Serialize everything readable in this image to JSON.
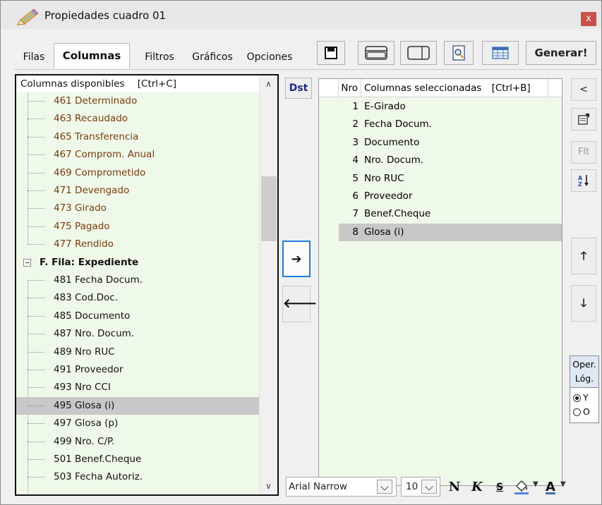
{
  "window": {
    "title": "Propiedades cuadro 01",
    "close_label": "x"
  },
  "tabs": [
    {
      "label": "Filas",
      "active": false
    },
    {
      "label": "Columnas",
      "active": true
    },
    {
      "label": "Filtros",
      "active": false
    },
    {
      "label": "Gráficos",
      "active": false
    },
    {
      "label": "Opciones",
      "active": false
    }
  ],
  "toolbar": {
    "buttons": [
      "save-icon",
      "layout-top-icon",
      "layout-split-icon",
      "preview-icon",
      "grid-icon"
    ],
    "generate_label": "Generar!"
  },
  "available_columns": {
    "header": "Columnas disponibles",
    "shortcut": "[Ctrl+C]",
    "rows": [
      {
        "label": "461 Determinado",
        "kind": "item",
        "color": "brown"
      },
      {
        "label": "463 Recaudado",
        "kind": "item",
        "color": "brown"
      },
      {
        "label": "465 Transferencia",
        "kind": "item",
        "color": "brown"
      },
      {
        "label": "467 Comprom. Anual",
        "kind": "item",
        "color": "brown"
      },
      {
        "label": "469 Comprometido",
        "kind": "item",
        "color": "brown"
      },
      {
        "label": "471 Devengado",
        "kind": "item",
        "color": "brown"
      },
      {
        "label": "473 Girado",
        "kind": "item",
        "color": "brown"
      },
      {
        "label": "475 Pagado",
        "kind": "item",
        "color": "brown"
      },
      {
        "label": "477 Rendido",
        "kind": "item",
        "color": "brown"
      },
      {
        "label": "F. Fila: Expediente",
        "kind": "group",
        "color": "black"
      },
      {
        "label": "481 Fecha Docum.",
        "kind": "item",
        "color": "black"
      },
      {
        "label": "483 Cod.Doc.",
        "kind": "item",
        "color": "black"
      },
      {
        "label": "485 Documento",
        "kind": "item",
        "color": "black"
      },
      {
        "label": "487 Nro. Docum.",
        "kind": "item",
        "color": "black"
      },
      {
        "label": "489 Nro RUC",
        "kind": "item",
        "color": "black"
      },
      {
        "label": "491 Proveedor",
        "kind": "item",
        "color": "black"
      },
      {
        "label": "493 Nro CCI",
        "kind": "item",
        "color": "black"
      },
      {
        "label": "495 Glosa (i)",
        "kind": "item",
        "color": "black",
        "selected": true
      },
      {
        "label": "497 Glosa (p)",
        "kind": "item",
        "color": "black"
      },
      {
        "label": "499 Nro. C/P.",
        "kind": "item",
        "color": "black"
      },
      {
        "label": "501 Benef.Cheque",
        "kind": "item",
        "color": "black"
      },
      {
        "label": "503 Fecha Autoriz.",
        "kind": "item",
        "color": "black"
      }
    ]
  },
  "middle": {
    "dst_label": "Dst",
    "add_glyph": "➔",
    "remove_glyph": "🡐"
  },
  "selected_columns": {
    "header_nro": "Nro",
    "header_name": "Columnas seleccionadas",
    "shortcut": "[Ctrl+B]",
    "rows": [
      {
        "nro": "1",
        "name": "E-Girado"
      },
      {
        "nro": "2",
        "name": "Fecha Docum."
      },
      {
        "nro": "3",
        "name": "Documento"
      },
      {
        "nro": "4",
        "name": "Nro. Docum."
      },
      {
        "nro": "5",
        "name": "Nro RUC"
      },
      {
        "nro": "6",
        "name": "Proveedor"
      },
      {
        "nro": "7",
        "name": "Benef.Cheque"
      },
      {
        "nro": "8",
        "name": "Glosa (i)",
        "selected": true
      }
    ]
  },
  "side_buttons": {
    "back_glyph": "<",
    "flt_label": "Flt",
    "up_glyph": "🡑",
    "down_glyph": "🡓"
  },
  "logic": {
    "label": "Oper. Lóg.",
    "options": [
      {
        "label": "Y",
        "checked": true
      },
      {
        "label": "O",
        "checked": false
      }
    ]
  },
  "format_bar": {
    "font": "Arial Narrow",
    "size": "10",
    "bold": "N",
    "italic": "K",
    "strike": "S",
    "font_color": "A"
  }
}
